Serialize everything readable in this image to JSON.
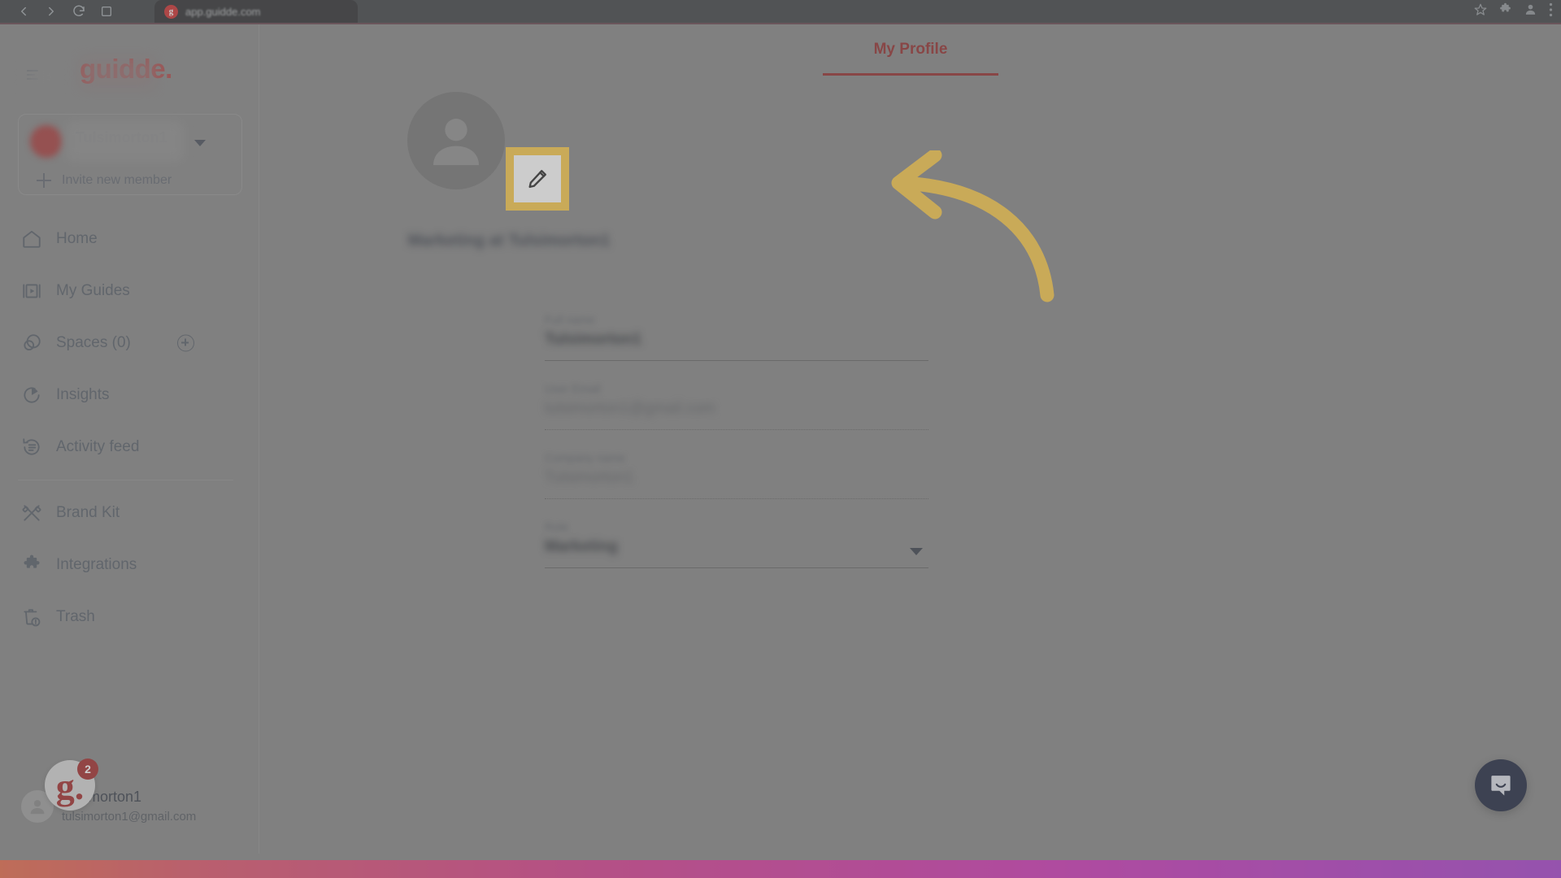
{
  "browser": {
    "url": "app.guidde.com",
    "favicon_label": "g",
    "back_icon": "back-arrow-icon",
    "forward_icon": "forward-arrow-icon",
    "reload_icon": "reload-icon",
    "home_icon": "home-icon",
    "bookmark_icon": "star-icon",
    "extensions_icon": "puzzle-icon",
    "profile_icon": "profile-avatar-icon",
    "menu_icon": "three-dots-icon"
  },
  "sidebar": {
    "brand": "guidde.",
    "menu_icon": "hamburger-icon",
    "workspace": {
      "name": "Tulsimorton1",
      "subtitle": "",
      "caret_icon": "chevron-down-icon",
      "invite_label": "Invite new member",
      "invite_icon": "plus-icon"
    },
    "items": [
      {
        "label": "Home",
        "icon": "home-icon"
      },
      {
        "label": "My Guides",
        "icon": "guides-icon"
      },
      {
        "label": "Spaces (0)",
        "icon": "spaces-icon",
        "action_icon": "plus-circle-icon"
      },
      {
        "label": "Insights",
        "icon": "insights-icon"
      },
      {
        "label": "Activity feed",
        "icon": "activity-feed-icon"
      },
      {
        "label": "Brand Kit",
        "icon": "brand-kit-icon"
      },
      {
        "label": "Integrations",
        "icon": "integrations-icon"
      },
      {
        "label": "Trash",
        "icon": "trash-icon"
      }
    ],
    "account": {
      "name": "tulsimorton1",
      "email": "tulsimorton1@gmail.com",
      "badge_glyph": "g.",
      "badge_count": "2",
      "avatar_icon": "user-avatar-icon"
    }
  },
  "main": {
    "tabs": [
      {
        "label": "My Profile",
        "active": true
      }
    ],
    "profile": {
      "avatar_icon": "user-avatar-icon",
      "display_name": "Marketing at Tulsimorton1",
      "edit_button_icon": "pencil-icon",
      "edit_button_label": "Edit profile photo"
    },
    "form": {
      "fields": [
        {
          "label": "Full name",
          "value": "Tulsimorton1",
          "type": "text",
          "line": "solid"
        },
        {
          "label": "User Email",
          "value": "tulsimorton1@gmail.com",
          "type": "text",
          "line": "dotted",
          "dim": true
        },
        {
          "label": "Company name",
          "value": "Tulsimorton1",
          "type": "text",
          "line": "dotted",
          "dim": true
        },
        {
          "label": "Role",
          "value": "Marketing",
          "type": "select",
          "line": "solid",
          "caret_icon": "chevron-down-icon"
        }
      ]
    }
  },
  "overlay": {
    "arrow_icon": "curved-left-arrow-icon",
    "highlight_color": "#fbc63f"
  },
  "widgets": {
    "intercom_icon": "chat-bubble-icon"
  },
  "colors": {
    "brand_red": "#b03838",
    "tab_active": "#8e2121",
    "highlight_yellow": "#fbc63f",
    "intercom_navy": "#121a34",
    "gradient_start": "#e8613f",
    "gradient_end": "#a436cc"
  }
}
